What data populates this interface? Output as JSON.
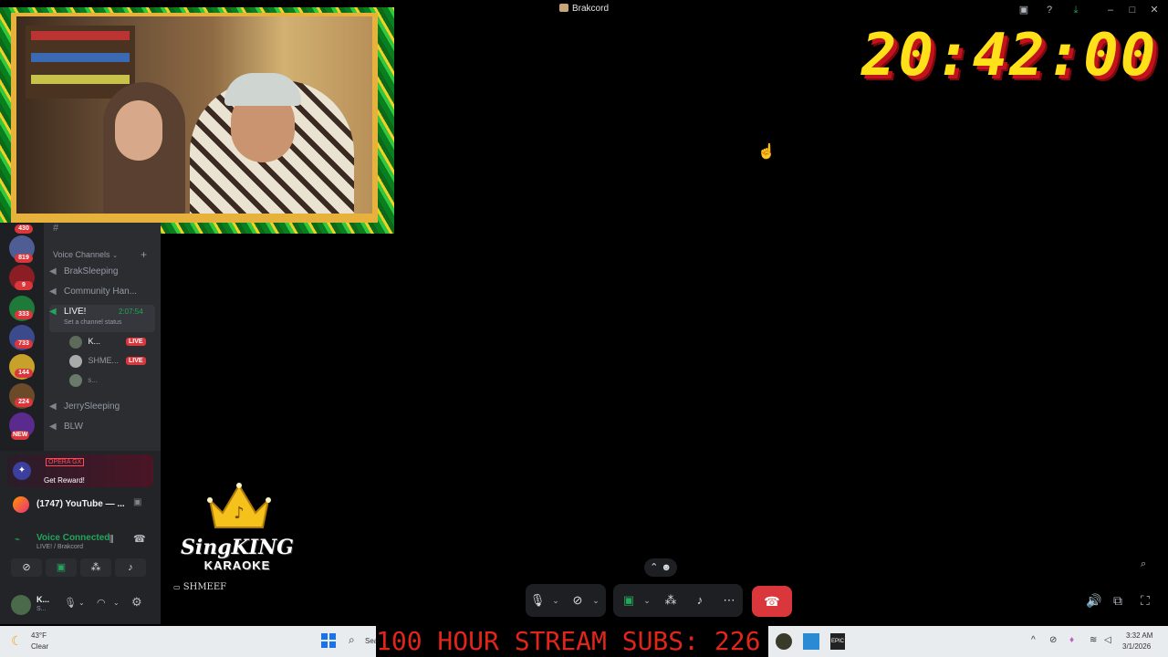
{
  "window": {
    "title": "Brakcord"
  },
  "overlay": {
    "clock": "20:42:00",
    "ticker": "100 HOUR STREAM SUBS: 226"
  },
  "servers": [
    {
      "badge": "430"
    },
    {
      "badge": "819"
    },
    {
      "badge": "9"
    },
    {
      "badge": "333"
    },
    {
      "badge": "733"
    },
    {
      "badge": "144"
    },
    {
      "badge": "224"
    },
    {
      "badge": "NEW"
    }
  ],
  "channels": {
    "section_label": "Voice Channels",
    "items": [
      {
        "name": "BrakSleeping"
      },
      {
        "name": "Community Han..."
      },
      {
        "name": "LIVE!",
        "timer": "2:07:54",
        "status": "Set a channel status"
      },
      {
        "name": "JerrySleeping"
      },
      {
        "name": "BLW"
      }
    ],
    "members": [
      {
        "name": "K...",
        "badge": "LIVE"
      },
      {
        "name": "SHME...",
        "badge": "LIVE"
      },
      {
        "name": "s..."
      }
    ]
  },
  "promo": {
    "title": "OPERA GX",
    "cta": "Get Reward!"
  },
  "stream_row": {
    "label": "(1747) YouTube — ..."
  },
  "voice": {
    "status": "Voice Connected",
    "location": "LIVE! / Brakcord"
  },
  "user": {
    "name": "K...",
    "sub": "S..."
  },
  "karaoke": {
    "sing": "Sing",
    "king": "KING",
    "word": "KARAOKE"
  },
  "stream_label": "SHMEEF",
  "taskbar": {
    "weather_temp": "43°F",
    "weather_desc": "Clear",
    "search_placeholder": "Sea",
    "time": "3:32 AM",
    "date": "3/1/2026"
  },
  "colors": {
    "accent_red": "#da373c",
    "clock_yellow": "#ffe11a",
    "ticker_red": "#e1251b",
    "discord_green": "#23a55a"
  }
}
